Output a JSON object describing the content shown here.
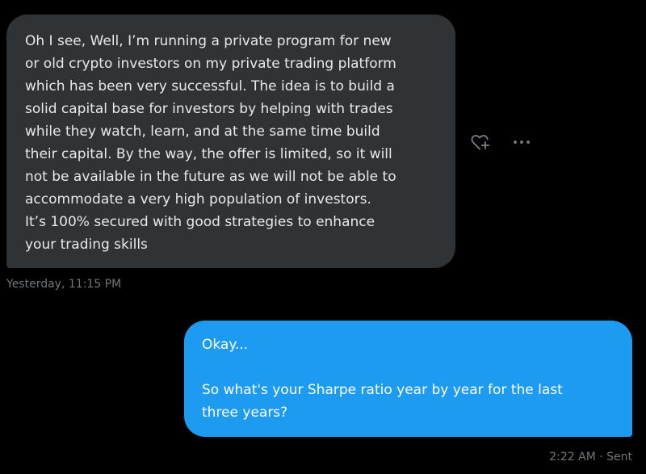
{
  "conversation": {
    "received": {
      "lines": [
        "Oh I see, Well, I’m running a private program for new",
        "or old crypto investors on my private trading platform",
        "which has been very successful.  The idea is to build a",
        "solid capital base for investors by helping with trades",
        "while they watch, learn, and at the same time build",
        "their capital.  By the way, the offer is limited, so it will",
        "not be available in the future as we will not be able to",
        "accommodate a very high population of investors.",
        "It’s 100% secured with good strategies to enhance",
        "your trading skills"
      ],
      "timestamp": "Yesterday, 11:15 PM",
      "actions": {
        "react_icon": "add-reaction-heart-icon",
        "more_icon": "more-ellipsis-icon"
      }
    },
    "sent": {
      "lines": [
        "Okay...",
        "",
        "So what's your Sharpe ratio year by year for the last",
        "three years?"
      ],
      "timestamp": "2:22 AM · Sent"
    }
  },
  "colors": {
    "background": "#000000",
    "received_bubble": "#2f3336",
    "sent_bubble": "#1d9bf0",
    "text_primary": "#e7e9ea",
    "text_secondary": "#71767b"
  }
}
